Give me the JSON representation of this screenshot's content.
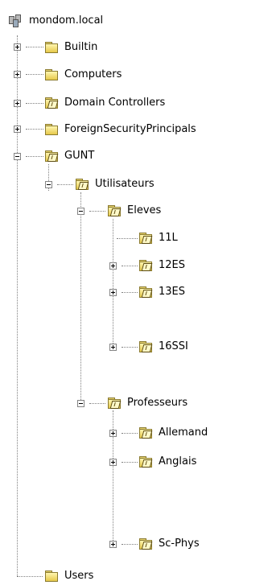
{
  "tree": {
    "root": {
      "label": "mondom.local",
      "icon": "domain-icon"
    },
    "items": [
      {
        "label": "Builtin",
        "icon": "folder-icon",
        "expander": "plus"
      },
      {
        "label": "Computers",
        "icon": "folder-icon",
        "expander": "plus"
      },
      {
        "label": "Domain Controllers",
        "icon": "organizational-unit-icon",
        "expander": "plus"
      },
      {
        "label": "ForeignSecurityPrincipals",
        "icon": "folder-icon",
        "expander": "plus"
      },
      {
        "label": "GUNT",
        "icon": "organizational-unit-icon",
        "expander": "minus"
      },
      {
        "label": "Utilisateurs",
        "icon": "organizational-unit-icon",
        "expander": "minus"
      },
      {
        "label": "Eleves",
        "icon": "organizational-unit-icon",
        "expander": "minus"
      },
      {
        "label": "11L",
        "icon": "organizational-unit-icon",
        "expander": "none"
      },
      {
        "label": "12ES",
        "icon": "organizational-unit-icon",
        "expander": "plus"
      },
      {
        "label": "13ES",
        "icon": "organizational-unit-icon",
        "expander": "plus"
      },
      {
        "label": "16SSI",
        "icon": "organizational-unit-icon",
        "expander": "plus"
      },
      {
        "label": "Professeurs",
        "icon": "organizational-unit-icon",
        "expander": "minus"
      },
      {
        "label": "Allemand",
        "icon": "organizational-unit-icon",
        "expander": "plus"
      },
      {
        "label": "Anglais",
        "icon": "organizational-unit-icon",
        "expander": "plus"
      },
      {
        "label": "Sc-Phys",
        "icon": "organizational-unit-icon",
        "expander": "plus"
      },
      {
        "label": "Users",
        "icon": "folder-icon",
        "expander": "none"
      }
    ]
  }
}
